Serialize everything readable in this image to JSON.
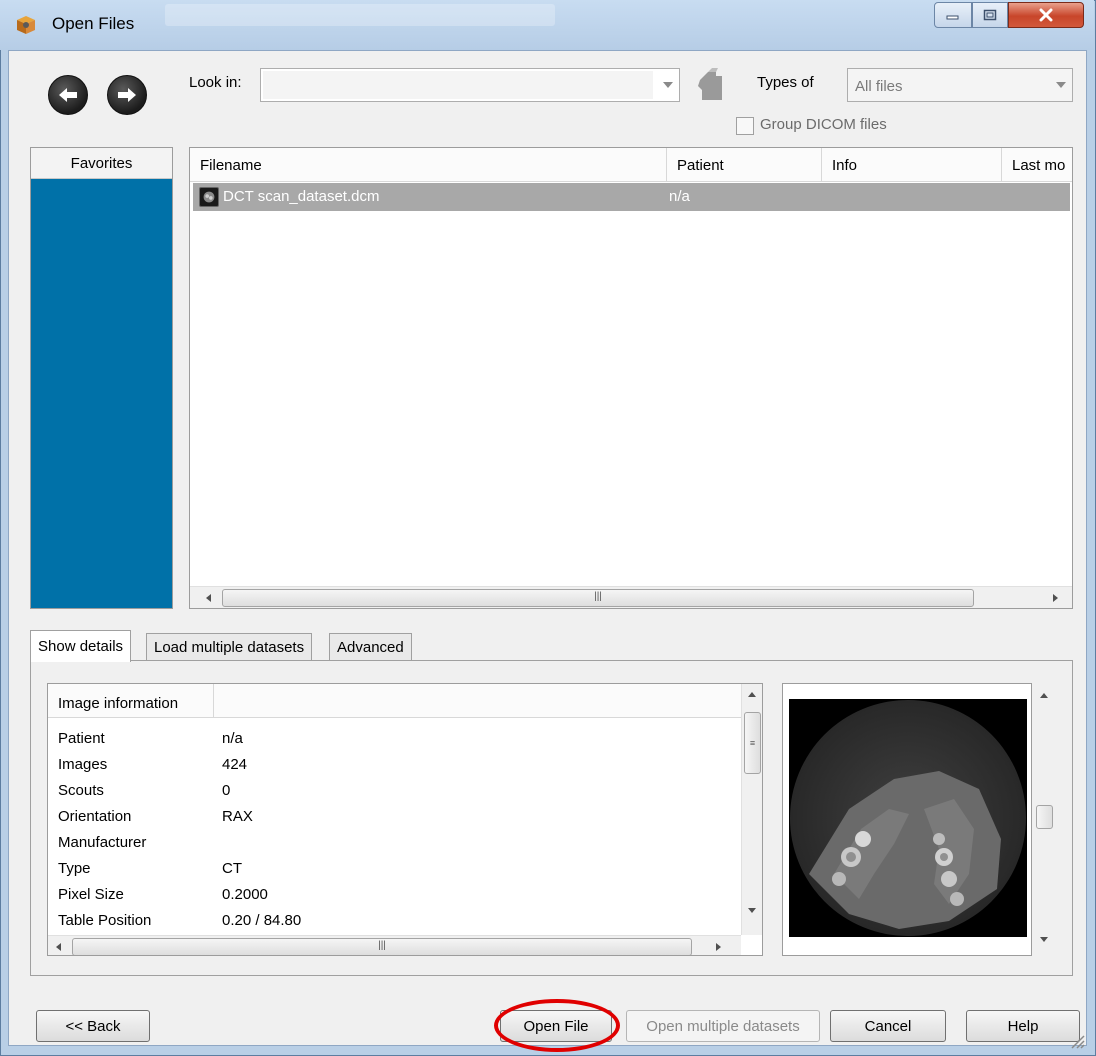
{
  "window": {
    "title": "Open Files"
  },
  "toolbar": {
    "look_in_label": "Look in:",
    "look_in_value": "",
    "types_label": "Types of",
    "types_value": "All files",
    "group_dicom_label": "Group DICOM files",
    "group_dicom_checked": false
  },
  "favorites": {
    "header": "Favorites"
  },
  "file_list": {
    "columns": [
      "Filename",
      "Patient",
      "Info",
      "Last mo"
    ],
    "rows": [
      {
        "filename": "DCT scan_dataset.dcm",
        "patient": "n/a",
        "info": "",
        "selected": true
      }
    ]
  },
  "tabs": [
    {
      "label": "Show details",
      "active": true
    },
    {
      "label": "Load multiple datasets",
      "active": false
    },
    {
      "label": "Advanced",
      "active": false
    }
  ],
  "details": {
    "header": "Image information",
    "rows": [
      {
        "key": "Patient",
        "value": "n/a"
      },
      {
        "key": "Images",
        "value": "424"
      },
      {
        "key": "Scouts",
        "value": "0"
      },
      {
        "key": "Orientation",
        "value": "RAX"
      },
      {
        "key": "Manufacturer",
        "value": ""
      },
      {
        "key": "Type",
        "value": "CT"
      },
      {
        "key": "Pixel Size",
        "value": "0.2000"
      },
      {
        "key": "Table Position",
        "value": "0.20 / 84.80"
      }
    ]
  },
  "buttons": {
    "back": "<< Back",
    "open_file": "Open File",
    "open_multiple": "Open multiple datasets",
    "cancel": "Cancel",
    "help": "Help"
  },
  "icons": {
    "app": "app-logo-icon",
    "minimize": "minimize-icon",
    "maximize": "maximize-icon",
    "close": "close-icon",
    "back": "arrow-left-icon",
    "forward": "arrow-right-icon",
    "up_folder": "up-folder-icon",
    "file": "dicom-file-icon"
  },
  "colors": {
    "favorites_bg": "#0071a8",
    "selected_row": "#a8a8a8",
    "highlight": "#e00000",
    "close_button": "#c8452a"
  }
}
